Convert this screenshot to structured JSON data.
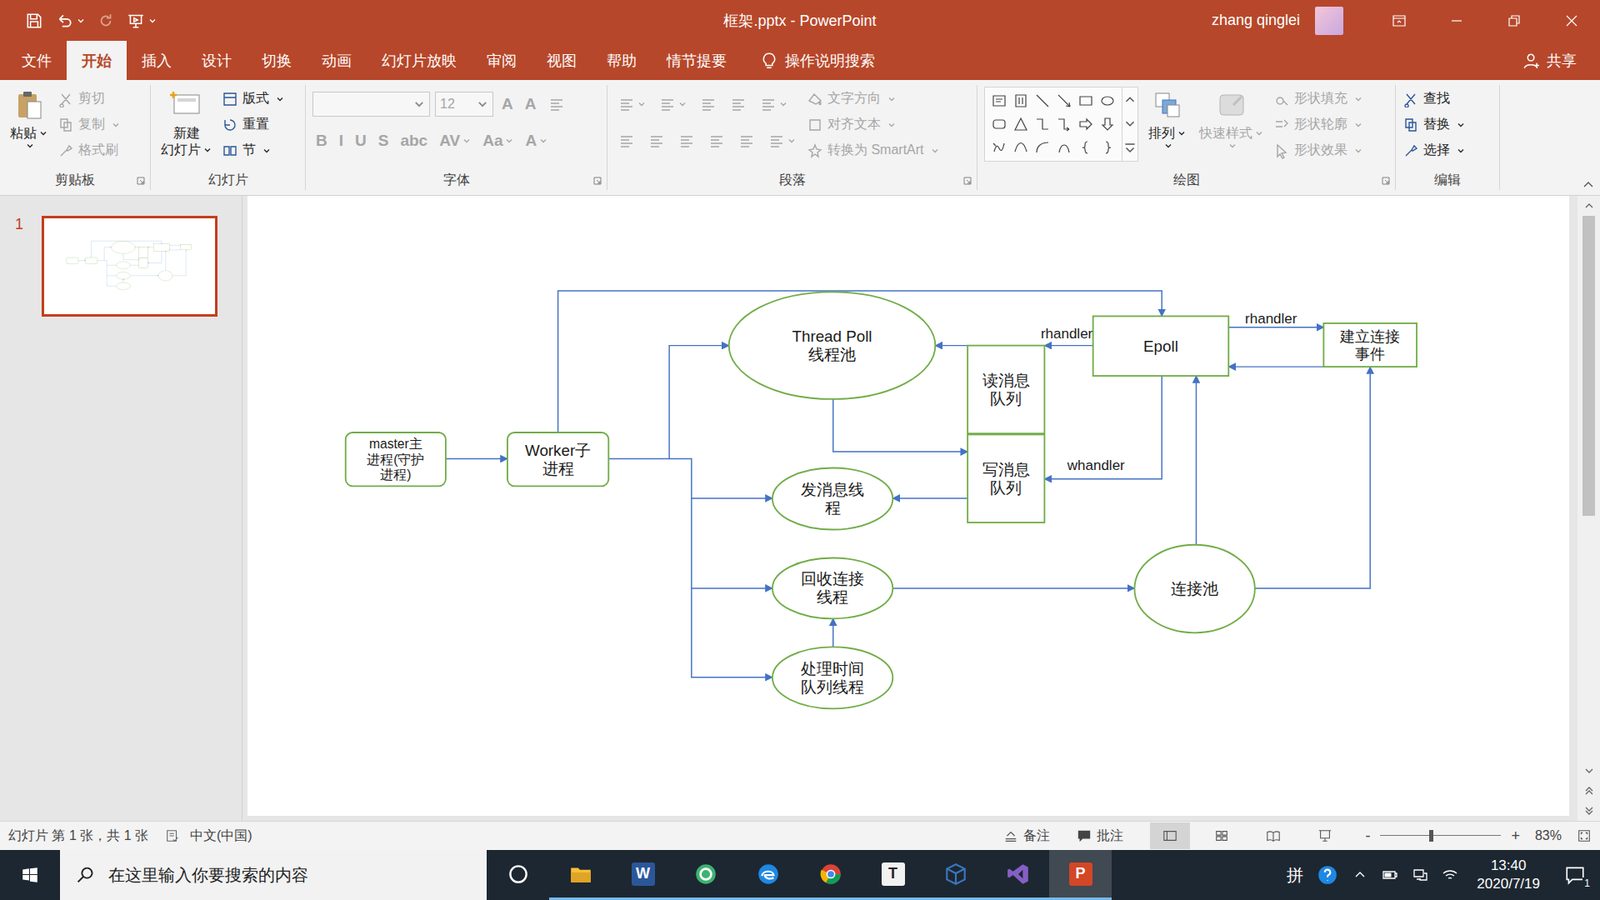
{
  "window": {
    "title": "框架.pptx - PowerPoint",
    "user": "zhang qinglei"
  },
  "menu_tabs": [
    {
      "label": "文件",
      "selected": false
    },
    {
      "label": "开始",
      "selected": true
    },
    {
      "label": "插入",
      "selected": false
    },
    {
      "label": "设计",
      "selected": false
    },
    {
      "label": "切换",
      "selected": false
    },
    {
      "label": "动画",
      "selected": false
    },
    {
      "label": "幻灯片放映",
      "selected": false
    },
    {
      "label": "审阅",
      "selected": false
    },
    {
      "label": "视图",
      "selected": false
    },
    {
      "label": "帮助",
      "selected": false
    },
    {
      "label": "情节提要",
      "selected": false
    }
  ],
  "tell_me": "操作说明搜索",
  "share": "共享",
  "ribbon": {
    "groups": [
      {
        "label": "剪贴板",
        "launcher": true,
        "parts": [
          {
            "kind": "large",
            "lines": [
              "粘贴"
            ],
            "disabled": false,
            "dropdown": true
          },
          {
            "kind": "stack",
            "items": [
              {
                "label": "剪切",
                "disabled": true,
                "dropdown": false
              },
              {
                "label": "复制",
                "disabled": true,
                "dropdown": true
              },
              {
                "label": "格式刷",
                "disabled": true,
                "dropdown": false
              }
            ]
          }
        ]
      },
      {
        "label": "幻灯片",
        "launcher": false,
        "parts": [
          {
            "kind": "large",
            "lines": [
              "新建",
              "幻灯片"
            ],
            "disabled": false,
            "dropdown": true
          },
          {
            "kind": "stack",
            "items": [
              {
                "label": "版式",
                "disabled": false,
                "dropdown": true
              },
              {
                "label": "重置",
                "disabled": false,
                "dropdown": false
              },
              {
                "label": "节",
                "disabled": false,
                "dropdown": true
              }
            ]
          }
        ]
      },
      {
        "label": "字体",
        "launcher": true,
        "parts": [
          {
            "kind": "rows",
            "rows": [
              [
                {
                  "kind": "font-field",
                  "text": "",
                  "disabled": true,
                  "dropdown": true
                },
                {
                  "kind": "size-field",
                  "text": "12",
                  "disabled": true,
                  "dropdown": true
                },
                {
                  "kind": "glyph",
                  "text": "A",
                  "disabled": true,
                  "dropdown": false
                },
                {
                  "kind": "glyph",
                  "text": "A",
                  "disabled": true,
                  "dropdown": false
                },
                {
                  "kind": "icon",
                  "disabled": true,
                  "dropdown": false
                }
              ],
              [
                {
                  "kind": "glyph",
                  "text": "B",
                  "disabled": true,
                  "dropdown": false
                },
                {
                  "kind": "glyph",
                  "text": "I",
                  "disabled": true,
                  "dropdown": false
                },
                {
                  "kind": "glyph",
                  "text": "U",
                  "disabled": true,
                  "dropdown": false
                },
                {
                  "kind": "glyph",
                  "text": "S",
                  "disabled": true,
                  "dropdown": false
                },
                {
                  "kind": "glyph",
                  "text": "abc",
                  "disabled": true,
                  "dropdown": false
                },
                {
                  "kind": "glyph",
                  "text": "AV",
                  "disabled": true,
                  "dropdown": true
                },
                {
                  "kind": "glyph",
                  "text": "Aa",
                  "disabled": true,
                  "dropdown": true
                },
                {
                  "kind": "glyph",
                  "text": "A",
                  "disabled": true,
                  "dropdown": true
                }
              ]
            ]
          }
        ]
      },
      {
        "label": "段落",
        "launcher": true,
        "parts": [
          {
            "kind": "rows",
            "rows": [
              [
                {
                  "kind": "icon",
                  "disabled": true,
                  "dropdown": true
                },
                {
                  "kind": "icon",
                  "disabled": true,
                  "dropdown": true
                },
                {
                  "kind": "icon",
                  "disabled": true,
                  "dropdown": false
                },
                {
                  "kind": "icon",
                  "disabled": true,
                  "dropdown": false
                },
                {
                  "kind": "icon",
                  "disabled": true,
                  "dropdown": true
                }
              ],
              [
                {
                  "kind": "icon",
                  "disabled": true,
                  "dropdown": false
                },
                {
                  "kind": "icon",
                  "disabled": true,
                  "dropdown": false
                },
                {
                  "kind": "icon",
                  "disabled": true,
                  "dropdown": false
                },
                {
                  "kind": "icon",
                  "disabled": true,
                  "dropdown": false
                },
                {
                  "kind": "icon",
                  "disabled": true,
                  "dropdown": false
                },
                {
                  "kind": "icon",
                  "disabled": true,
                  "dropdown": true
                }
              ]
            ]
          },
          {
            "kind": "stack",
            "items": [
              {
                "label": "文字方向",
                "disabled": true,
                "dropdown": true
              },
              {
                "label": "对齐文本",
                "disabled": true,
                "dropdown": true
              },
              {
                "label": "转换为 SmartArt",
                "disabled": true,
                "dropdown": true
              }
            ]
          }
        ]
      },
      {
        "label": "绘图",
        "launcher": true,
        "parts": [
          {
            "kind": "gallery"
          },
          {
            "kind": "large",
            "lines": [
              "排列"
            ],
            "disabled": false,
            "dropdown": true
          },
          {
            "kind": "large",
            "lines": [
              "快速样式"
            ],
            "disabled": true,
            "dropdown": true
          },
          {
            "kind": "stack",
            "items": [
              {
                "label": "形状填充",
                "disabled": true,
                "dropdown": true
              },
              {
                "label": "形状轮廓",
                "disabled": true,
                "dropdown": true
              },
              {
                "label": "形状效果",
                "disabled": true,
                "dropdown": true
              }
            ]
          }
        ]
      },
      {
        "label": "编辑",
        "launcher": false,
        "parts": [
          {
            "kind": "stack",
            "items": [
              {
                "label": "查找",
                "disabled": false,
                "dropdown": false
              },
              {
                "label": "替换",
                "disabled": false,
                "dropdown": true
              },
              {
                "label": "选择",
                "disabled": false,
                "dropdown": true
              }
            ]
          }
        ]
      }
    ]
  },
  "thumbnails": [
    {
      "number": "1",
      "selected": true
    }
  ],
  "scrollbar": {
    "position": 0.0,
    "size": 0.55
  },
  "diagram": {
    "nodes": [
      {
        "shape": "rounded",
        "lines": [
          "master主",
          "进程(守护",
          "进程)"
        ]
      },
      {
        "shape": "rounded",
        "lines": [
          "Worker子",
          "进程"
        ]
      },
      {
        "shape": "ellipse",
        "lines": [
          "Thread Poll",
          "线程池"
        ]
      },
      {
        "shape": "rect",
        "lines": [
          "读消息",
          "队列"
        ]
      },
      {
        "shape": "rect",
        "lines": [
          "写消息",
          "队列"
        ]
      },
      {
        "shape": "rect",
        "lines": [
          "Epoll"
        ]
      },
      {
        "shape": "rect",
        "lines": [
          "建立连接",
          "事件"
        ]
      },
      {
        "shape": "ellipse",
        "lines": [
          "发消息线",
          "程"
        ]
      },
      {
        "shape": "ellipse",
        "lines": [
          "回收连接",
          "线程"
        ]
      },
      {
        "shape": "ellipse",
        "lines": [
          "处理时间",
          "队列线程"
        ]
      },
      {
        "shape": "ellipse",
        "lines": [
          "连接池"
        ]
      }
    ],
    "edge_labels": [
      "rhandler",
      "rhandler",
      "whandler"
    ]
  },
  "status_bar": {
    "slide_info": "幻灯片 第 1 张，共 1 张",
    "language": "中文(中国)",
    "notes": "备注",
    "comments": "批注",
    "views": [
      {
        "kind": "normal",
        "selected": true
      },
      {
        "kind": "sorter",
        "selected": false
      },
      {
        "kind": "reading",
        "selected": false
      },
      {
        "kind": "slideshow",
        "selected": false
      }
    ],
    "zoom_out": "-",
    "zoom_in": "+",
    "zoom": "83%",
    "zoom_level": 0.42
  },
  "taskbar": {
    "search": "在这里输入你要搜索的内容",
    "apps": [
      {
        "kind": "cortana",
        "glyph": "",
        "running": false,
        "selected": false,
        "color": "#ffffff"
      },
      {
        "kind": "folder",
        "glyph": "",
        "running": true,
        "selected": false,
        "color": "#f8c13a"
      },
      {
        "kind": "letter",
        "glyph": "W",
        "running": true,
        "selected": false,
        "color": "#2b579a"
      },
      {
        "kind": "circle",
        "glyph": "",
        "running": true,
        "selected": false,
        "color": "#3cb371"
      },
      {
        "kind": "edge",
        "glyph": "",
        "running": true,
        "selected": false,
        "color": "#1e88e5"
      },
      {
        "kind": "chrome",
        "glyph": "",
        "running": true,
        "selected": false,
        "color": "#db4437"
      },
      {
        "kind": "letter",
        "glyph": "T",
        "running": true,
        "selected": false,
        "color": "#f2f2f2"
      },
      {
        "kind": "cube",
        "glyph": "",
        "running": true,
        "selected": false,
        "color": "#3a76c1"
      },
      {
        "kind": "vs",
        "glyph": "",
        "running": true,
        "selected": false,
        "color": "#865fc5"
      },
      {
        "kind": "letter",
        "glyph": "P",
        "running": true,
        "selected": true,
        "color": "#d24726"
      }
    ],
    "ime": "拼",
    "time": "13:40",
    "date": "2020/7/19",
    "notifications": "1"
  }
}
